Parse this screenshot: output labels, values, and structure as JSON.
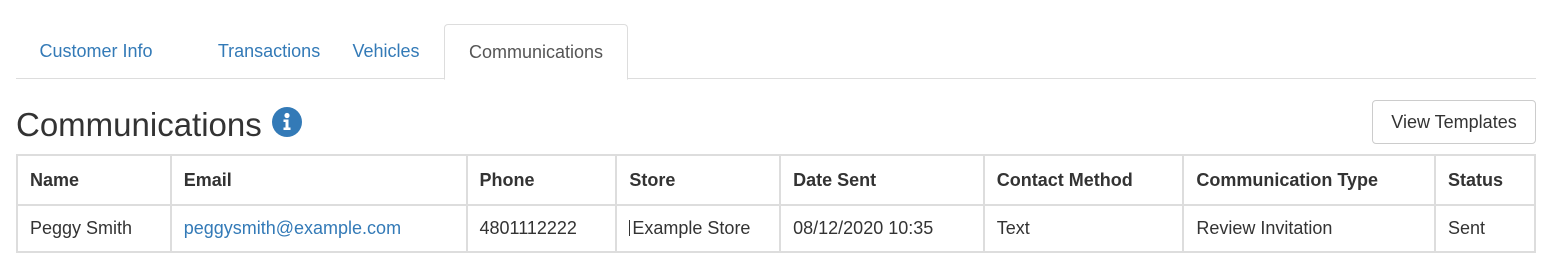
{
  "tabs": [
    {
      "label": "Customer Info",
      "active": false
    },
    {
      "label": "Transactions",
      "active": false
    },
    {
      "label": "Vehicles",
      "active": false
    },
    {
      "label": "Communications",
      "active": true
    }
  ],
  "header": {
    "title": "Communications",
    "info_icon": "info-circle-icon",
    "view_templates_label": "View Templates"
  },
  "table": {
    "columns": [
      "Name",
      "Email",
      "Phone",
      "Store",
      "Date Sent",
      "Contact Method",
      "Communication Type",
      "Status"
    ],
    "rows": [
      {
        "name": "Peggy Smith",
        "email": "peggysmith@example.com",
        "phone": "4801112222",
        "store": "Example Store",
        "date_sent": "08/12/2020 10:35",
        "contact_method": "Text",
        "communication_type": "Review Invitation",
        "status": "Sent"
      }
    ]
  },
  "colors": {
    "link": "#337ab7",
    "border": "#dddddd",
    "text": "#333333",
    "info_icon": "#337ab7"
  }
}
